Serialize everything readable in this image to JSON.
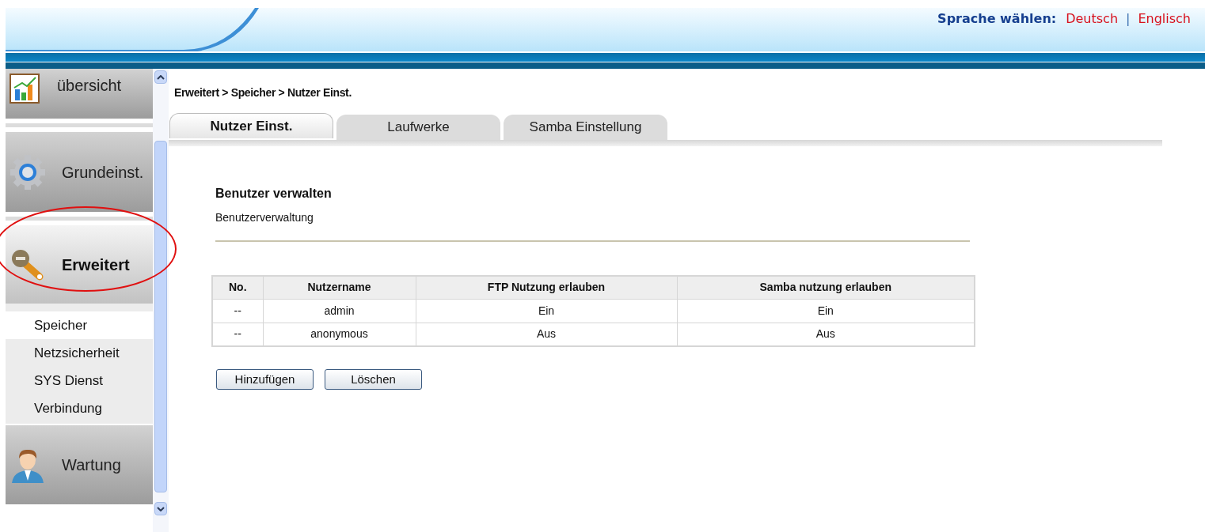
{
  "header": {
    "language_label": "Sprache wählen:",
    "languages": [
      {
        "label": "Deutsch"
      },
      {
        "label": "Englisch"
      }
    ],
    "separator": "|"
  },
  "sidebar": {
    "sections": [
      {
        "label": "übersicht",
        "selected": false,
        "circled": false
      },
      {
        "label": "Grundeinst.",
        "selected": false,
        "circled": false
      },
      {
        "label": "Erweitert",
        "selected": true,
        "circled": true,
        "items": [
          {
            "label": "Speicher",
            "selected": true
          },
          {
            "label": "Netzsicherheit",
            "selected": false
          },
          {
            "label": "SYS Dienst",
            "selected": false
          },
          {
            "label": "Verbindung",
            "selected": false
          }
        ]
      },
      {
        "label": "Wartung",
        "selected": false,
        "circled": false
      }
    ]
  },
  "breadcrumb": "Erweitert > Speicher > Nutzer Einst.",
  "tabs": [
    {
      "label": "Nutzer Einst.",
      "selected": true
    },
    {
      "label": "Laufwerke",
      "selected": false
    },
    {
      "label": "Samba Einstellung",
      "selected": false
    }
  ],
  "section": {
    "title": "Benutzer verwalten",
    "subtitle": "Benutzerverwaltung"
  },
  "table": {
    "columns": [
      "No.",
      "Nutzername",
      "FTP Nutzung erlauben",
      "Samba nutzung erlauben"
    ],
    "rows": [
      [
        "--",
        "admin",
        "Ein",
        "Ein"
      ],
      [
        "--",
        "anonymous",
        "Aus",
        "Aus"
      ]
    ]
  },
  "buttons": [
    "Hinzufügen",
    "Löschen"
  ]
}
